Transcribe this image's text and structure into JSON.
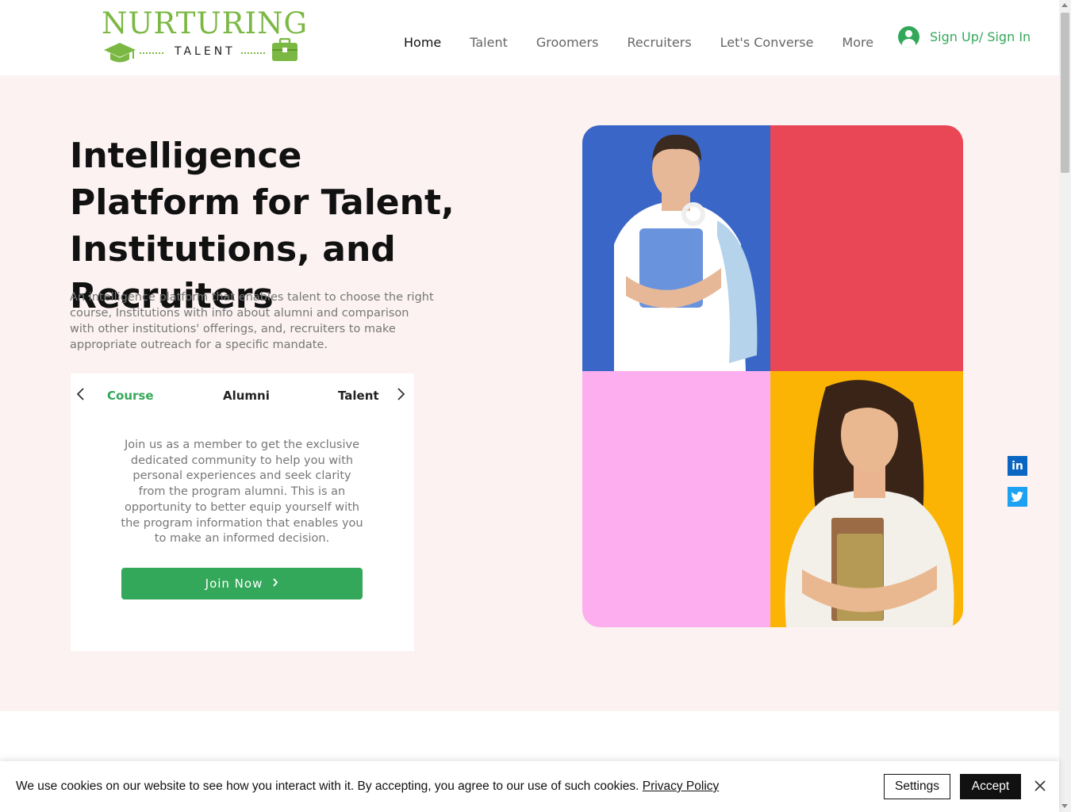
{
  "logo": {
    "wordmark": "NURTURING",
    "subtitle": "TALENT",
    "icons": [
      "graduation-cap-icon",
      "briefcase-icon"
    ]
  },
  "nav": {
    "items": [
      {
        "label": "Home",
        "active": true
      },
      {
        "label": "Talent",
        "active": false
      },
      {
        "label": "Groomers",
        "active": false
      },
      {
        "label": "Recruiters",
        "active": false
      },
      {
        "label": "Let's Converse",
        "active": false
      },
      {
        "label": "More",
        "active": false
      }
    ],
    "signin_label": "Sign Up/ Sign In"
  },
  "hero": {
    "title": "Intelligence Platform for Talent, Institutions, and Recruiters",
    "description": "An intelligence platform that enables talent to choose the right course, Institutions with info about alumni and comparison with other institutions' offerings, and, recruiters to make appropriate outreach for a specific mandate."
  },
  "tabs": {
    "items": [
      {
        "label": "Course",
        "active": true
      },
      {
        "label": "Alumni",
        "active": false
      },
      {
        "label": "Talent",
        "active": false
      }
    ],
    "content": "Join us as a member to get the exclusive dedicated community to help you with personal experiences and seek clarity from the program alumni. This is an opportunity to better equip yourself with the program information that enables you to make an informed decision.",
    "cta_label": "Join Now"
  },
  "collage": {
    "colors": [
      "#3a66c8",
      "#e94656",
      "#fdaeee",
      "#fbb404"
    ]
  },
  "social": [
    "linkedin-icon",
    "twitter-icon"
  ],
  "cookie": {
    "text": "We use cookies on our website to see how you interact with it. By accepting, you agree to our use of such cookies.",
    "link_label": "Privacy Policy",
    "settings_label": "Settings",
    "accept_label": "Accept"
  },
  "colors": {
    "brand_green": "#34a85a",
    "logo_green": "#7bb843",
    "hero_bg": "#fcf2f2"
  }
}
